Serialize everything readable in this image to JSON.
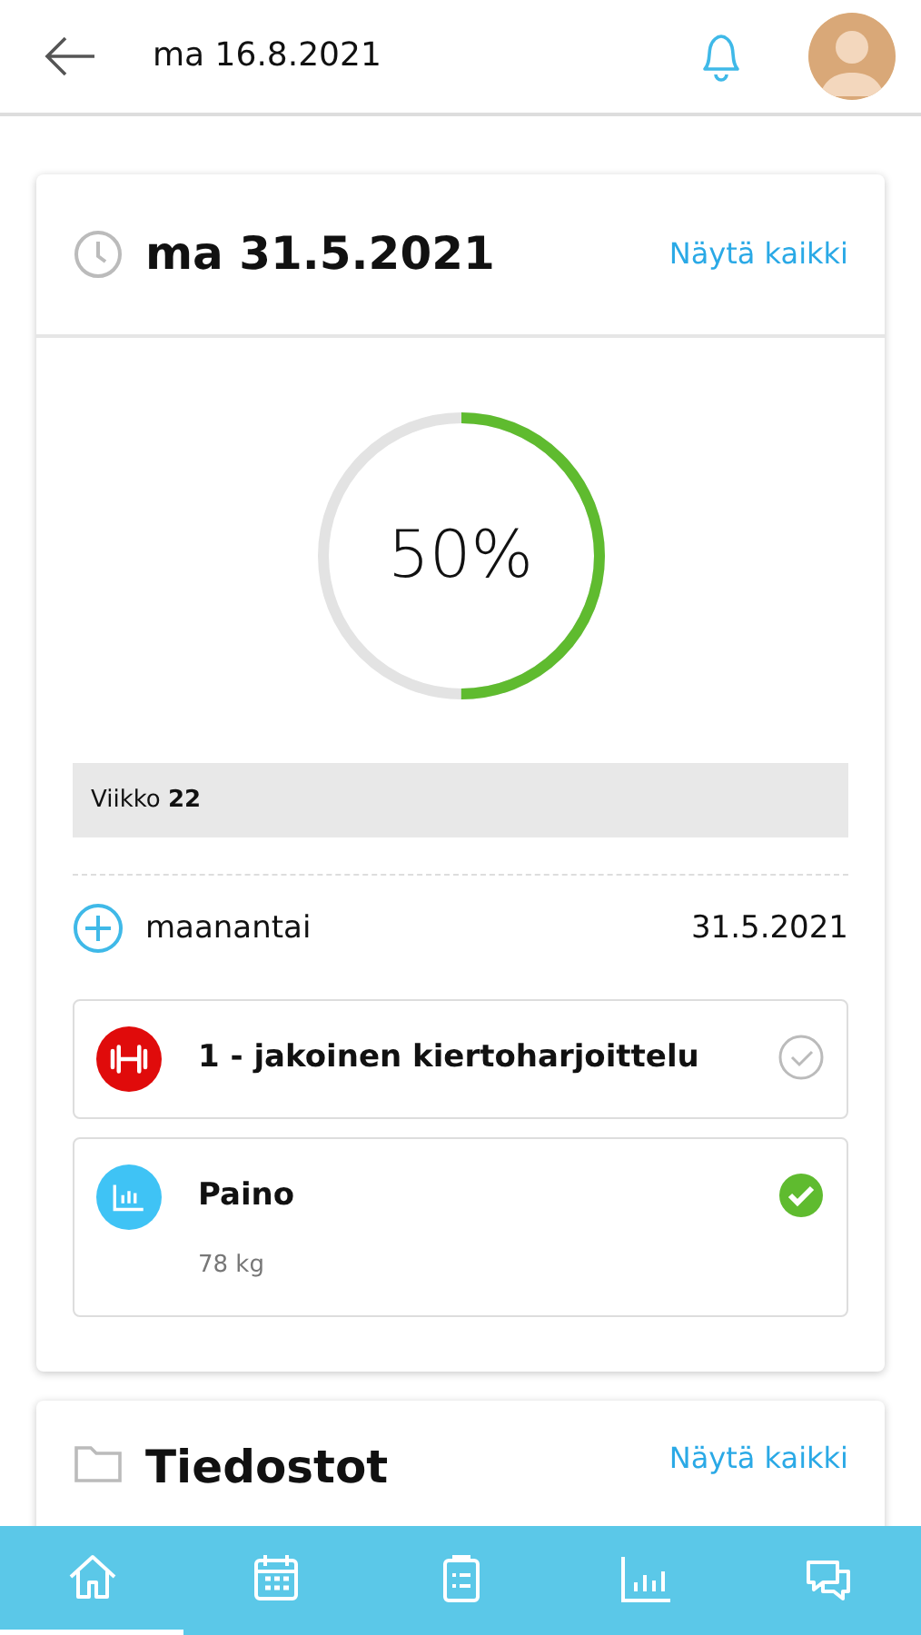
{
  "header": {
    "title": "ma 16.8.2021"
  },
  "day_card": {
    "title": "ma 31.5.2021",
    "link": "Näytä kaikki",
    "progress": {
      "level": 0.5,
      "reading": "50%"
    },
    "week": "Viikko **22**",
    "day": {
      "name": "maanantai",
      "date": "31.5.2021"
    },
    "entries": [
      {
        "kind": "workout",
        "title": "1 - jakoinen kiertoharjoittelu",
        "done": false,
        "color": "#e00b0b"
      },
      {
        "kind": "measurement",
        "title": "Paino",
        "value": "78 kg",
        "done": true,
        "color": "#3fc3f5"
      }
    ]
  },
  "files_card": {
    "title": "Tiedostot",
    "link": "Näytä kaikki"
  },
  "tab_bar": [
    {
      "kind": "home",
      "selected": true
    },
    {
      "kind": "calendar",
      "selected": false
    },
    {
      "kind": "clipboard",
      "selected": false
    },
    {
      "kind": "chart",
      "selected": false
    },
    {
      "kind": "chat",
      "selected": false
    }
  ]
}
